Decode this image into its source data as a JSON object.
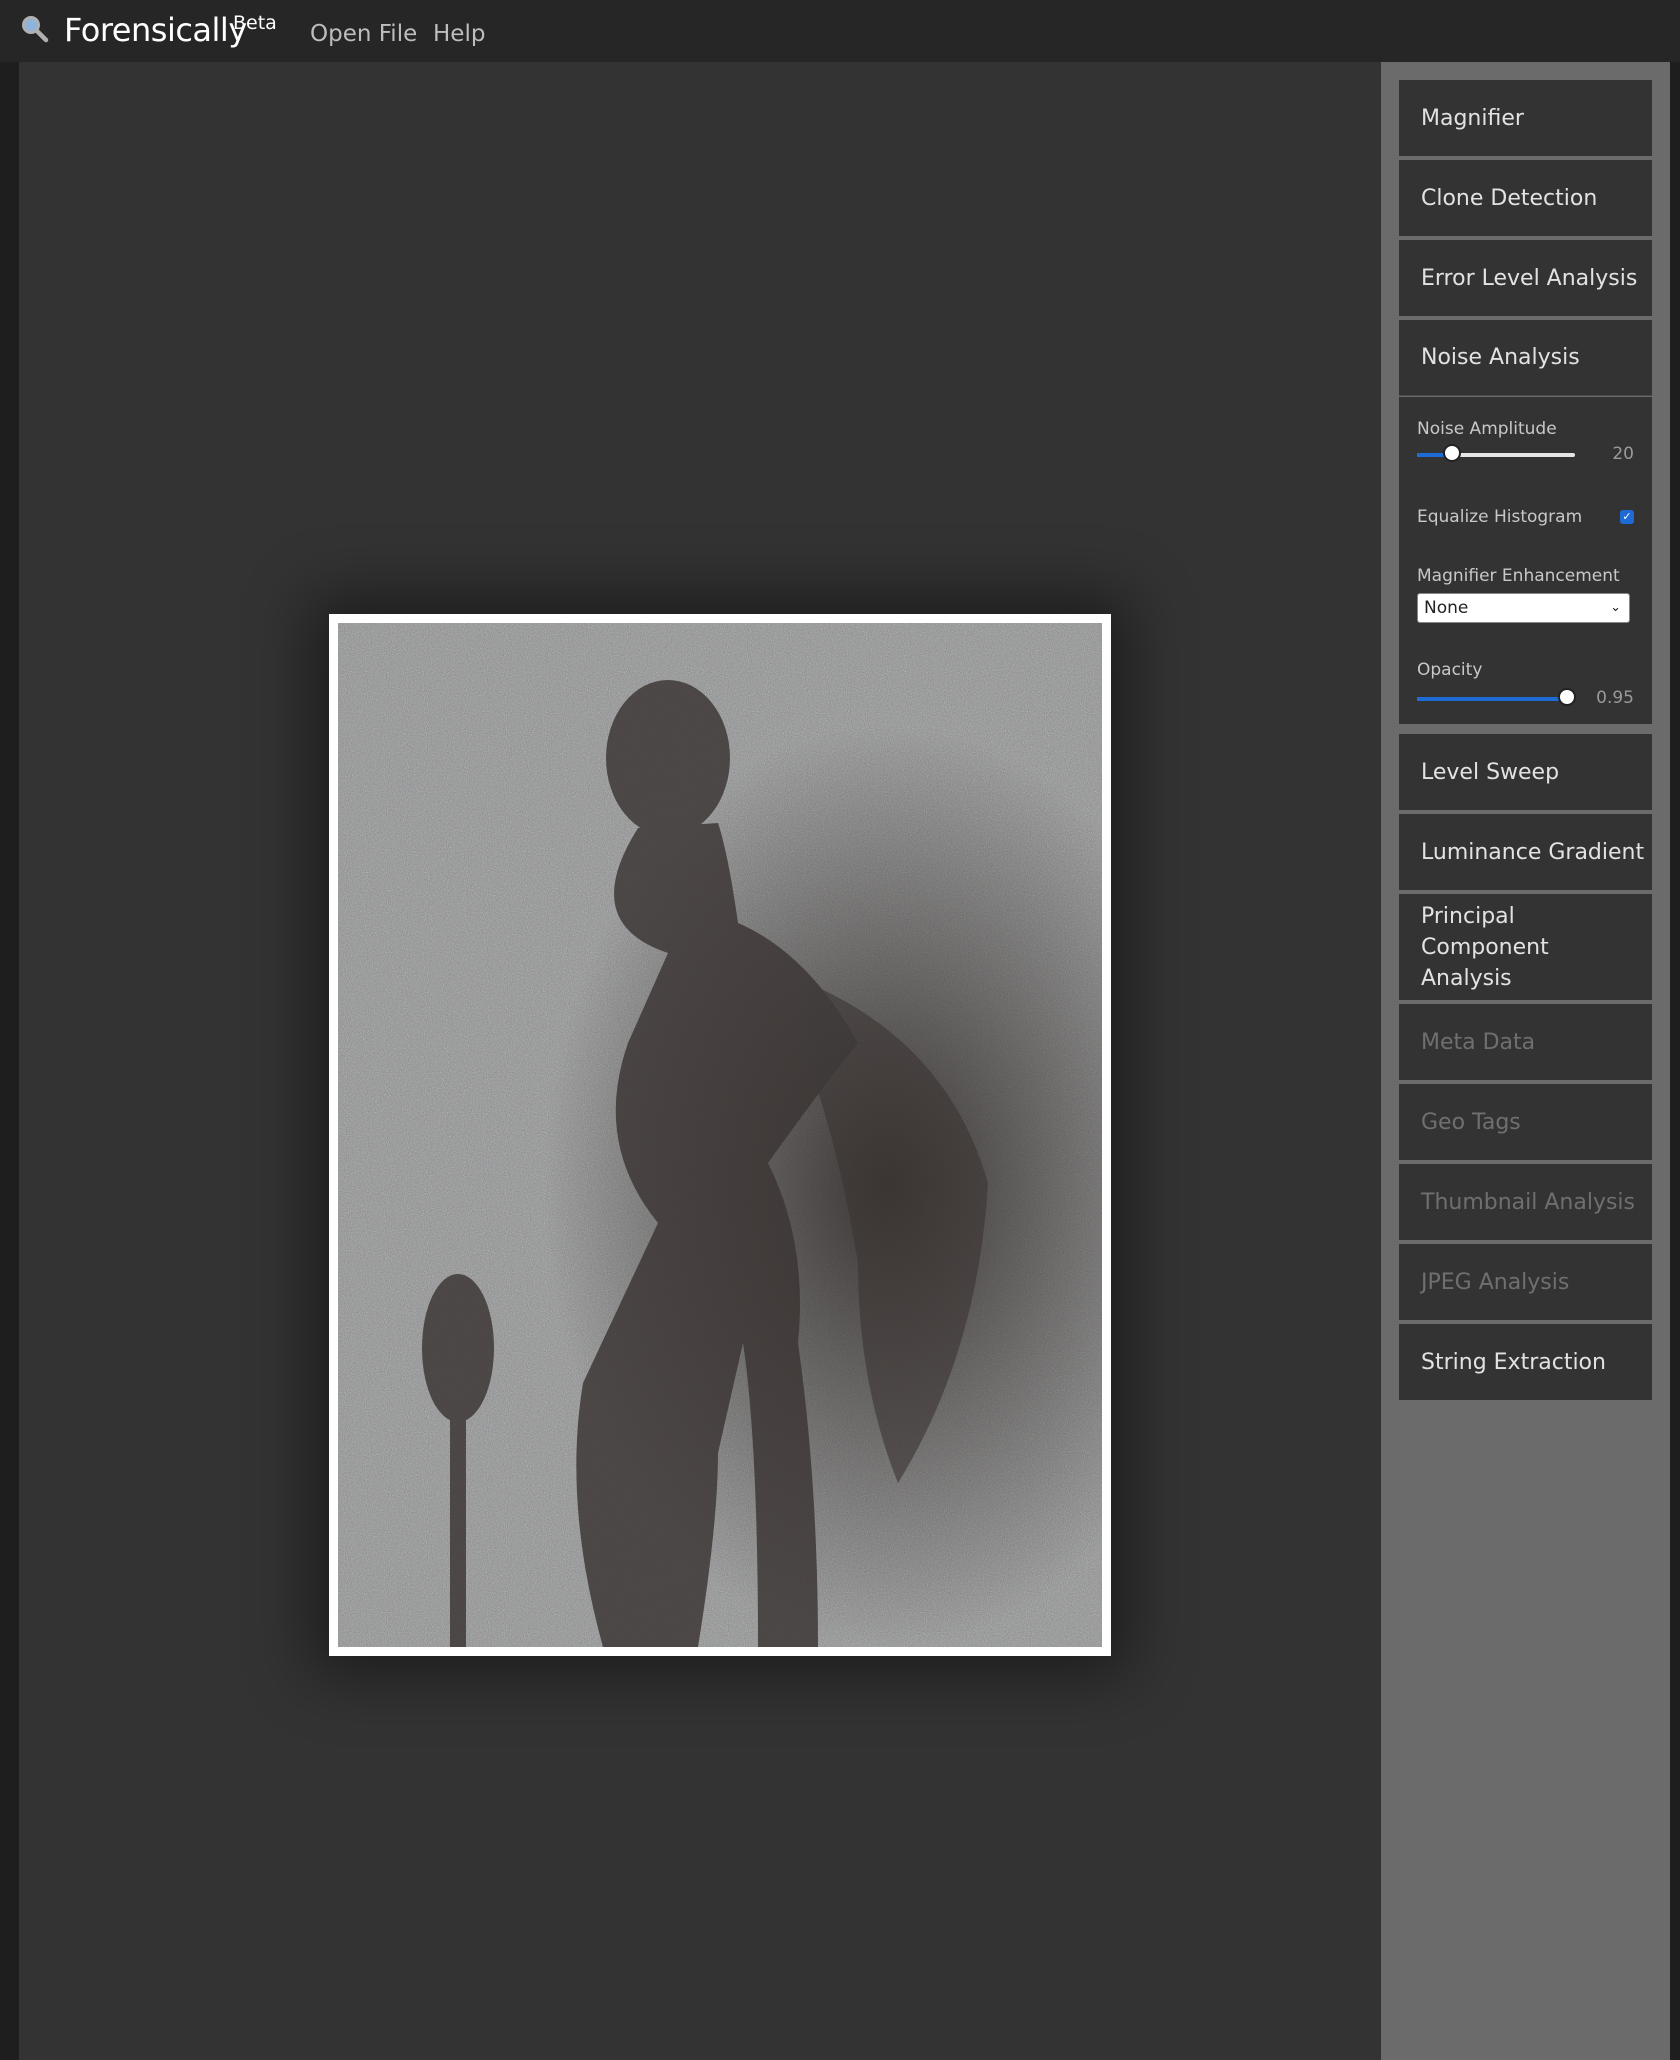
{
  "app": {
    "title": "Forensically",
    "superscript": "Beta"
  },
  "menu": {
    "open_file": "Open File",
    "help": "Help"
  },
  "tools": {
    "magnifier": "Magnifier",
    "clone_detection": "Clone Detection",
    "error_level_analysis": "Error Level Analysis",
    "noise_analysis": "Noise Analysis",
    "level_sweep": "Level Sweep",
    "luminance_gradient": "Luminance Gradient",
    "principal_component_analysis": "Principal Component Analysis",
    "meta_data": "Meta Data",
    "geo_tags": "Geo Tags",
    "thumbnail_analysis": "Thumbnail Analysis",
    "jpeg_analysis": "JPEG Analysis",
    "string_extraction": "String Extraction"
  },
  "noise_panel": {
    "noise_amplitude_label": "Noise Amplitude",
    "noise_amplitude_value": "20",
    "noise_amplitude_fraction": 0.22,
    "equalize_histogram_label": "Equalize Histogram",
    "equalize_histogram_checked": true,
    "magnifier_enhancement_label": "Magnifier Enhancement",
    "magnifier_enhancement_value": "None",
    "opacity_label": "Opacity",
    "opacity_value": "0.95",
    "opacity_fraction": 0.95
  },
  "icons": {
    "logo": "magnifier-icon",
    "checkbox": "checkmark-icon",
    "select": "chevron-down-icon"
  },
  "colors": {
    "accent": "#1f6bd6",
    "topbar": "#262626",
    "canvas": "#333333",
    "sidebar": "#6b6b6b",
    "tool_bg": "#333333",
    "disabled_text": "#6f6f6f"
  }
}
